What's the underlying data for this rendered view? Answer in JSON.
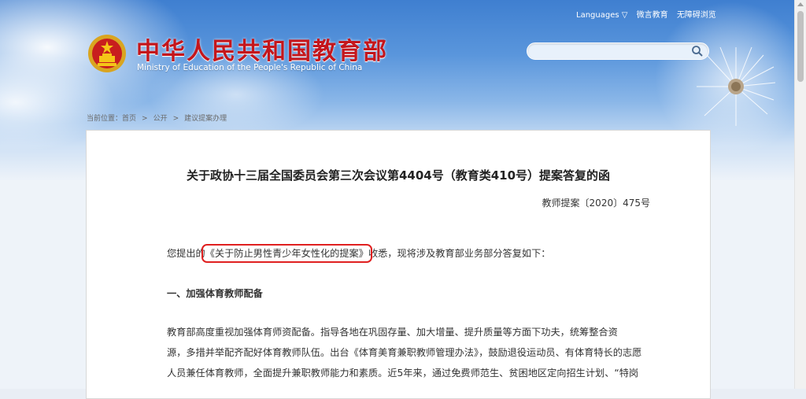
{
  "header": {
    "title_cn": "中华人民共和国教育部",
    "title_en": "Ministry of Education of the People's Republic of China",
    "top_links": [
      "Languages ▽",
      "微言教育",
      "无障碍浏览"
    ],
    "search": {
      "placeholder": ""
    }
  },
  "breadcrumb": {
    "prefix": "当前位置：",
    "items": [
      "首页",
      "公开",
      "建议提案办理"
    ],
    "separator": ">"
  },
  "document": {
    "title": "关于政协十三届全国委员会第三次会议第4404号（教育类410号）提案答复的函",
    "number": "教师提案〔2020〕475号",
    "intro_before": "您提出的",
    "intro_highlight": "《关于防止男性青少年女性化的提案》",
    "intro_after": "收悉，现将涉及教育部业务部分答复如下：",
    "section_heading": "一、加强体育教师配备",
    "body_lines": [
      "教育部高度重视加强体育师资配备。指导各地在巩固存量、加大增量、提升质量等方面下功夫，统筹整合资",
      "源，多措并举配齐配好体育教师队伍。出台《体育美育兼职教师管理办法》，鼓励退役运动员、有体育特长的志愿",
      "人员兼任体育教师，全面提升兼职教师能力和素质。近5年来，通过免费师范生、贫困地区定向招生计划、“特岗"
    ]
  },
  "colors": {
    "title_red": "#c4161c",
    "highlight_border": "#e02020"
  },
  "icons": {
    "emblem": "national-emblem-icon",
    "search": "search-icon"
  }
}
